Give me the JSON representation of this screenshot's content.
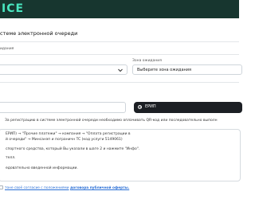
{
  "header": {
    "brand": "ICE"
  },
  "page": {
    "title": "стеме электронной очереди"
  },
  "form": {
    "field1_label": "идания",
    "field2_label": "Зона ожидания",
    "field2_value": "Выберите зона ожидания",
    "payment_option": "ЕРИП"
  },
  "info": {
    "notice": "За регистрацию в системе электронной очереди необходимо оплачивать QR-код или последовательно выполн",
    "steps": [
      "ЕРИП) → \"Прочие платежи\" → компания → \"Оплата регистрации в",
      "й очереди\" → Минсанэп и пограничн TC (код услуги 5149061)",
      "спортного средства, который Вы указали в шаге 2 и нажмите \"Инфо\".",
      "телл.",
      "едовательно введенной информации."
    ]
  },
  "footer": {
    "prefix": "тоне своё согласие с положениями",
    "link": "договора публичной оферты."
  }
}
